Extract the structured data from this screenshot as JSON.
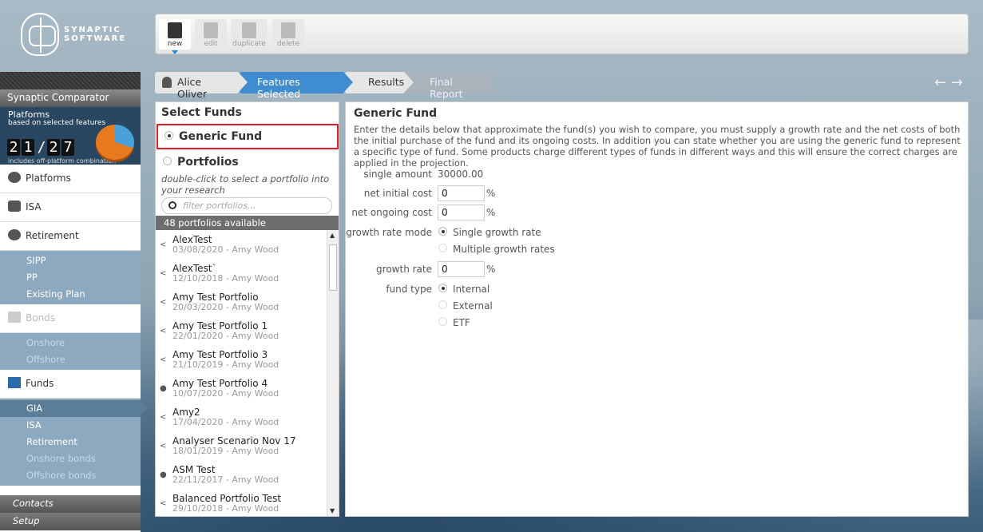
{
  "brand": {
    "line1": "SYNAPTIC",
    "line2": "SOFTWARE"
  },
  "toolbar": {
    "new": "new",
    "edit": "edit",
    "duplicate": "duplicate",
    "delete": "delete"
  },
  "sidebar": {
    "header": "Synaptic Comparator",
    "platforms_widget": {
      "title": "Platforms",
      "subtitle": "based on selected features",
      "digits_a": [
        "2",
        "1"
      ],
      "sep": "/",
      "digits_b": [
        "2",
        "7"
      ],
      "footnote": "includes off-platform combination"
    },
    "nav": {
      "platforms": "Platforms",
      "isa": "ISA",
      "retirement": "Retirement",
      "bonds": "Bonds",
      "funds": "Funds"
    },
    "retirement_sub": [
      "SIPP",
      "PP",
      "Existing Plan"
    ],
    "bonds_sub": [
      "Onshore",
      "Offshore"
    ],
    "funds_sub": [
      "GIA",
      "ISA",
      "Retirement",
      "Onshore bonds",
      "Offshore bonds"
    ],
    "contacts": "Contacts",
    "setup": "Setup"
  },
  "crumbs": {
    "client": "Alice Oliver",
    "features": "Features Selected",
    "results": "Results",
    "final": "Final Report"
  },
  "nav_arrows": {
    "back": "←",
    "forward": "→"
  },
  "funds": {
    "title": "Select Funds",
    "generic": "Generic Fund",
    "portfolios": "Portfolios",
    "hint": "double-click to select a portfolio into your research",
    "filter_placeholder": "filter portfolios...",
    "count": "48 portfolios available",
    "items": [
      {
        "name": "AlexTest",
        "meta": "03/08/2020 - Amy Wood",
        "icon": "share"
      },
      {
        "name": "AlexTest`",
        "meta": "12/10/2018 - Amy Wood",
        "icon": "share"
      },
      {
        "name": "Amy Test Portfolio",
        "meta": "20/03/2020 - Amy Wood",
        "icon": "share"
      },
      {
        "name": "Amy Test Portfolio 1",
        "meta": "22/01/2020 - Amy Wood",
        "icon": "share"
      },
      {
        "name": "Amy Test Portfolio 3",
        "meta": "21/10/2019 - Amy Wood",
        "icon": "share"
      },
      {
        "name": "Amy Test Portfolio 4",
        "meta": "10/07/2020 - Amy Wood",
        "icon": "user"
      },
      {
        "name": "Amy2",
        "meta": "17/04/2020 - Amy Wood",
        "icon": "share"
      },
      {
        "name": "Analyser Scenario Nov 17",
        "meta": "18/01/2019 - Amy Wood",
        "icon": "share"
      },
      {
        "name": "ASM Test",
        "meta": "22/11/2017 - Amy Wood",
        "icon": "user"
      },
      {
        "name": "Balanced Portfolio Test",
        "meta": "29/10/2018 - Amy Wood",
        "icon": "share"
      }
    ]
  },
  "generic": {
    "title": "Generic Fund",
    "desc": "Enter the details below that approximate the fund(s) you wish to compare, you must supply a growth rate and the net costs of both the initial purchase of the fund and its ongoing costs. In addition you can state whether you are using the generic fund to represent a specific type of fund. Some products charge different types of funds in different ways and this will ensure the correct charges are applied in the projection.",
    "single_amount_label": "single amount",
    "single_amount": "30000.00",
    "initial_label": "net initial cost",
    "initial": "0",
    "ongoing_label": "net ongoing cost",
    "ongoing": "0",
    "mode_label": "growth rate mode",
    "mode_single": "Single growth rate",
    "mode_multi": "Multiple growth rates",
    "growth_label": "growth rate",
    "growth": "0",
    "type_label": "fund type",
    "type_internal": "Internal",
    "type_external": "External",
    "type_etf": "ETF",
    "pct": "%"
  }
}
